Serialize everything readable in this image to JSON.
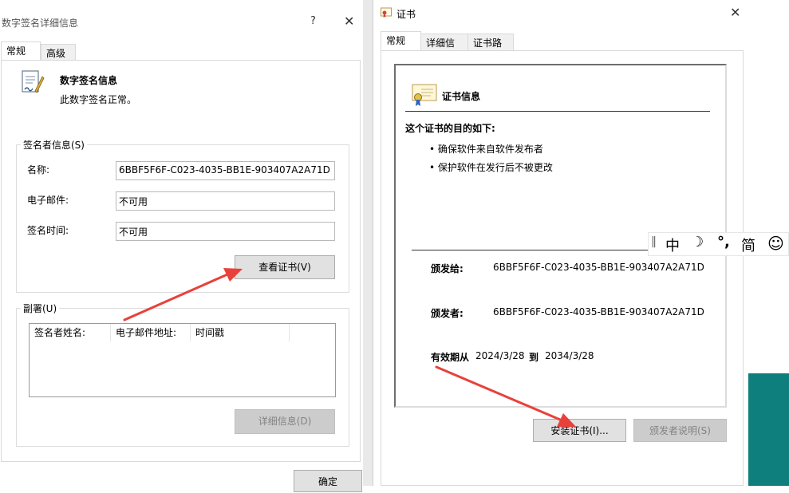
{
  "sig_window": {
    "title": "数字签名详细信息",
    "help_glyph": "?",
    "close_glyph": "✕",
    "tabs": [
      "常规",
      "高级"
    ],
    "header_title": "数字签名信息",
    "header_subtitle": "此数字签名正常。",
    "signer_group_label": "签名者信息(S)",
    "name_label": "名称:",
    "name_value": "6BBF5F6F-C023-4035-BB1E-903407A2A71D",
    "email_label": "电子邮件:",
    "email_value": "不可用",
    "time_label": "签名时间:",
    "time_value": "不可用",
    "view_cert_button": "查看证书(V)",
    "countersign_group_label": "副署(U)",
    "countersign_columns": [
      "签名者姓名:",
      "电子邮件地址:",
      "时间戳"
    ],
    "details_button": "详细信息(D)",
    "ok_button": "确定"
  },
  "cert_window": {
    "title": "证书",
    "close_glyph": "✕",
    "tabs": [
      "常规",
      "详细信息",
      "证书路径"
    ],
    "info_title": "证书信息",
    "purpose_heading": "这个证书的目的如下:",
    "purposes": [
      "确保软件来自软件发布者",
      "保护软件在发行后不被更改"
    ],
    "issued_to_label": "颁发给:",
    "issued_to_value": "6BBF5F6F-C023-4035-BB1E-903407A2A71D",
    "issued_by_label": "颁发者:",
    "issued_by_value": "6BBF5F6F-C023-4035-BB1E-903407A2A71D",
    "valid_from_label": "有效期从",
    "valid_from_value": "2024/3/28",
    "valid_to_label": "到",
    "valid_to_value": "2034/3/28",
    "install_button": "安装证书(I)...",
    "issuer_statement_button": "颁发者说明(S)"
  },
  "ime_toolbar": {
    "separator": "‖",
    "mode": "中",
    "moon": "☽",
    "punct": "°,",
    "script": "简",
    "emoji": "☺"
  },
  "colors": {
    "arrow_red": "#e8413a",
    "teal_background": "#0f7f7d",
    "cert_ribbon_blue": "#2a64c8"
  }
}
